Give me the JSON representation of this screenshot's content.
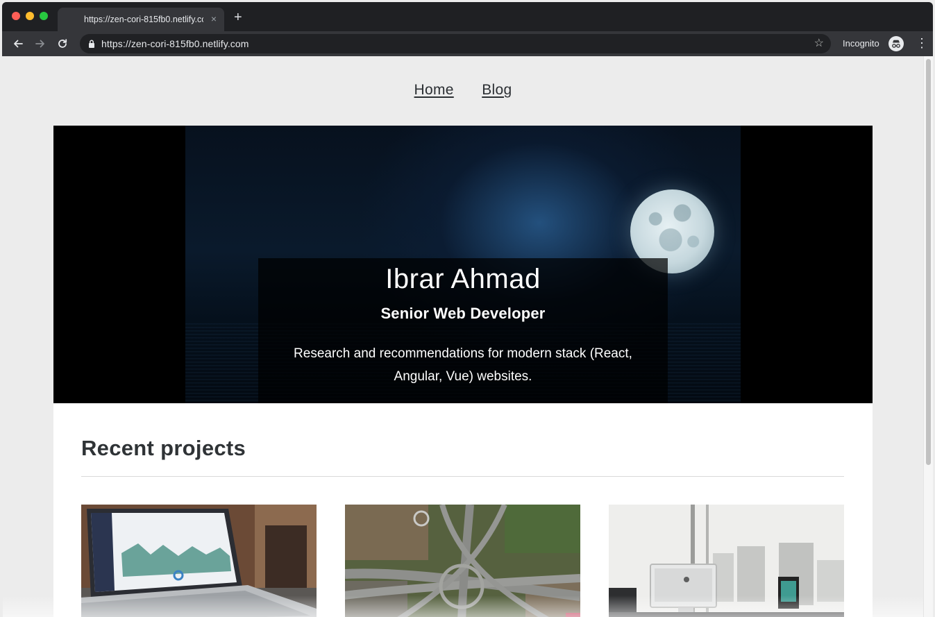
{
  "browser": {
    "tab_title": "https://zen-cori-815fb0.netlify.com",
    "tab_close": "×",
    "new_tab": "+",
    "url": "https://zen-cori-815fb0.netlify.com",
    "incognito_label": "Incognito",
    "bookmark_star": "☆",
    "menu": "⋮"
  },
  "site": {
    "nav": [
      "Home",
      "Blog"
    ],
    "hero": {
      "name": "Ibrar Ahmad",
      "role": "Senior Web Developer",
      "description": "Research and recommendations for modern stack (React, Angular, Vue) websites."
    },
    "section_title": "Recent projects",
    "projects": [
      {
        "image": "laptop-dashboard"
      },
      {
        "image": "aerial-highway-interchange"
      },
      {
        "image": "office-desk-imac"
      }
    ]
  },
  "colors": {
    "chrome_dark": "#1f2023",
    "chrome_toolbar": "#35363a",
    "page_bg": "#ececec",
    "text_dark": "#2b2f33"
  }
}
